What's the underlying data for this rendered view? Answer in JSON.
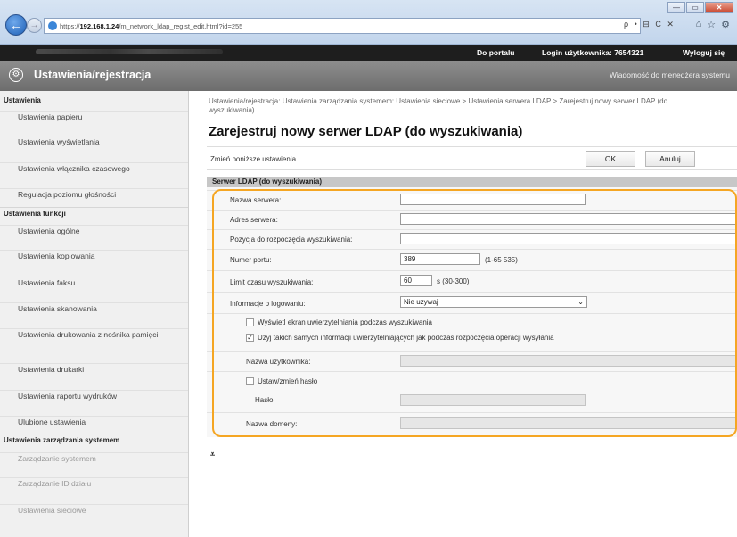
{
  "browser": {
    "address_host": "192.168.1.24",
    "address_prefix": "https://",
    "address_path": "/m_network_ldap_regist_edit.html?id=255",
    "address_controls": "ρ • ⊟ C ✕",
    "win_min": "—",
    "win_max": "▭",
    "win_close": "✕"
  },
  "topbar": {
    "portal": "Do portalu",
    "login": "Login użytkownika:  7654321",
    "logout": "Wyloguj się"
  },
  "titlebar": {
    "title": "Ustawienia/rejestracja",
    "message": "Wiadomość do menedżera systemu"
  },
  "sidebar": {
    "head_settings": "Ustawienia",
    "items_settings": [
      "Ustawienia papieru",
      "Ustawienia wyświetlania",
      "Ustawienia włącznika czasowego",
      "Regulacja poziomu głośności"
    ],
    "head_functions": "Ustawienia funkcji",
    "items_functions": [
      "Ustawienia ogólne",
      "Ustawienia kopiowania",
      "Ustawienia faksu",
      "Ustawienia skanowania",
      "Ustawienia drukowania z nośnika pamięci",
      "Ustawienia drukarki",
      "Ustawienia raportu wydruków",
      "Ulubione ustawienia"
    ],
    "head_system": "Ustawienia zarządzania systemem",
    "items_system": [
      "Zarządzanie systemem",
      "Zarządzanie ID działu",
      "Ustawienia sieciowe"
    ]
  },
  "main": {
    "breadcrumb": "Ustawienia/rejestracja: Ustawienia zarządzania systemem: Ustawienia sieciowe > Ustawienia serwera LDAP > Zarejestruj nowy serwer LDAP (do wyszukiwania)",
    "page_title": "Zarejestruj nowy serwer LDAP (do wyszukiwania)",
    "instruction": "Zmień poniższe ustawienia.",
    "ok_label": "OK",
    "cancel_label": "Anuluj",
    "section_title": "Serwer LDAP (do wyszukiwania)"
  },
  "form": {
    "server_name_label": "Nazwa serwera:",
    "server_name_value": "",
    "server_address_label": "Adres serwera:",
    "server_address_value": "",
    "search_start_label": "Pozycja do rozpoczęcia wyszukiwania:",
    "search_start_value": "",
    "port_label": "Numer portu:",
    "port_value": "389",
    "port_range": "(1-65 535)",
    "timeout_label": "Limit czasu wyszukiwania:",
    "timeout_value": "60",
    "timeout_unit": "s (30-300)",
    "login_info_label": "Informacje o logowaniu:",
    "login_info_value": "Nie używaj",
    "show_auth_label": "Wyświetl ekran uwierzytelniania podczas wyszukiwania",
    "show_auth_checked": false,
    "use_same_auth_label": "Użyj takich samych informacji uwierzytelniających jak podczas rozpoczęcia operacji wysyłania",
    "use_same_auth_checked": true,
    "username_label": "Nazwa użytkownika:",
    "set_password_label": "Ustaw/zmień hasło",
    "set_password_checked": false,
    "password_label": "Hasło:",
    "domain_label": "Nazwa domeny:"
  },
  "to_top": "⩡"
}
